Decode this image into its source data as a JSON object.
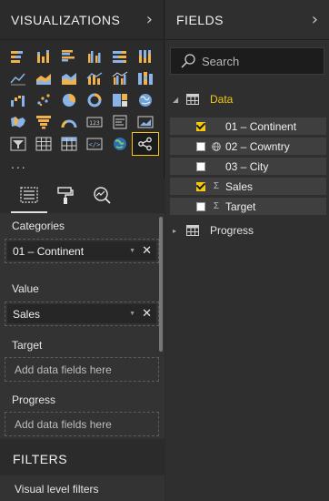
{
  "visualizations": {
    "title": "VISUALIZATIONS",
    "collapse_icon": "chevron-right-icon",
    "icons": [
      "stacked-bar-chart",
      "stacked-column-chart",
      "clustered-bar-chart",
      "clustered-column-chart",
      "100-percent-stacked-bar-chart",
      "100-percent-stacked-column-chart",
      "line-chart",
      "area-chart",
      "stacked-area-chart",
      "line-and-stacked-column-chart",
      "line-and-clustered-column-chart",
      "ribbon-chart",
      "waterfall-chart",
      "scatter-chart",
      "pie-chart",
      "donut-chart",
      "treemap",
      "map",
      "filled-map",
      "funnel",
      "gauge",
      "card",
      "multi-row-card",
      "kpi",
      "slicer",
      "table",
      "matrix",
      "r-script-visual",
      "globe-map",
      "custom-visual-selected"
    ],
    "more_label": "...",
    "sub_tabs": [
      "fields-tab",
      "format-tab",
      "analytics-tab"
    ],
    "wells": {
      "categories": {
        "label": "Categories",
        "value": "01 – Continent"
      },
      "value": {
        "label": "Value",
        "value": "Sales"
      },
      "target": {
        "label": "Target",
        "placeholder": "Add data fields here"
      },
      "progress": {
        "label": "Progress",
        "placeholder": "Add data fields here"
      }
    }
  },
  "filters": {
    "title": "FILTERS",
    "visual_level": "Visual level filters"
  },
  "fields": {
    "title": "FIELDS",
    "collapse_icon": "chevron-right-icon",
    "search_placeholder": "Search",
    "tables": [
      {
        "name": "Data",
        "expanded": true,
        "fields": [
          {
            "name": "01 – Continent",
            "checked": true,
            "type": ""
          },
          {
            "name": "02 – Cowntry",
            "checked": false,
            "type": "globe"
          },
          {
            "name": "03 – City",
            "checked": false,
            "type": ""
          },
          {
            "name": "Sales",
            "checked": true,
            "type": "sigma"
          },
          {
            "name": "Target",
            "checked": false,
            "type": "sigma"
          }
        ]
      },
      {
        "name": "Progress",
        "expanded": false,
        "fields": []
      }
    ]
  },
  "colors": {
    "accent": "#f2c811",
    "background": "#2b2b2b",
    "well_bg": "#333333"
  }
}
